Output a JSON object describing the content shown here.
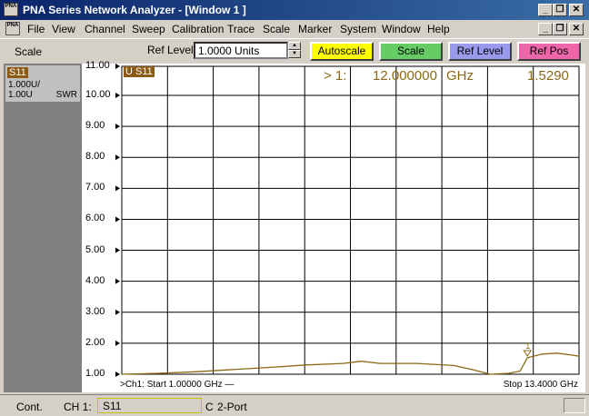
{
  "window": {
    "app_icon_text": "PNA",
    "title": "PNA Series Network Analyzer - [Window 1 ]",
    "controls": {
      "minimize": "_",
      "restore": "❐",
      "close": "✕"
    }
  },
  "menubar": {
    "items": [
      "File",
      "View",
      "Channel",
      "Sweep",
      "Calibration",
      "Trace",
      "Scale",
      "Marker",
      "System",
      "Window",
      "Help"
    ]
  },
  "toolbar": {
    "scale_label": "Scale",
    "ref_level_label": "Ref Level",
    "ref_level_value": "1.0000 Units",
    "spin_up": "▲",
    "spin_down": "▼",
    "buttons": [
      {
        "label": "Autoscale",
        "color": "#ffff00"
      },
      {
        "label": "Scale",
        "color": "#66cc66"
      },
      {
        "label": "Ref Level",
        "color": "#9999ee"
      },
      {
        "label": "Ref Pos",
        "color": "#ee66aa"
      }
    ]
  },
  "trace_panel": {
    "name": "S11",
    "scale_line1": "1.000U/",
    "scale_line2": "1.00U",
    "format": "SWR"
  },
  "plot": {
    "trace_label": "U S11",
    "marker_readout": {
      "marker": "> 1:",
      "frequency": "12.000000",
      "unit": "GHz",
      "value": "1.5290"
    },
    "y_ticks": [
      "11.00",
      "10.00",
      "9.00",
      "8.00",
      "7.00",
      "6.00",
      "5.00",
      "4.00",
      "3.00",
      "2.00",
      "1.00"
    ],
    "footer_left": ">Ch1: Start  1.00000 GHz —",
    "footer_right": "Stop  13.4000 GHz",
    "marker_number": "1",
    "trace_color": "#8b6914"
  },
  "chart_data": {
    "type": "line",
    "title": "",
    "xlabel": "",
    "ylabel": "",
    "xlim": [
      1.0,
      13.4
    ],
    "ylim": [
      1.0,
      11.0
    ],
    "x_unit": "GHz",
    "series": [
      {
        "x": [
          1.0,
          2.0,
          3.0,
          4.0,
          5.0,
          6.0,
          7.0,
          7.5,
          8.0,
          9.0,
          10.0,
          10.5,
          11.0,
          11.5,
          11.8,
          12.0,
          12.4,
          12.8,
          13.2,
          13.4
        ],
        "values": [
          1.0,
          1.03,
          1.08,
          1.15,
          1.22,
          1.3,
          1.35,
          1.42,
          1.35,
          1.35,
          1.28,
          1.15,
          1.0,
          1.03,
          1.1,
          1.53,
          1.65,
          1.68,
          1.62,
          1.58
        ]
      }
    ],
    "markers": [
      {
        "label": "1",
        "x": 12.0,
        "y": 1.529
      }
    ]
  },
  "statusbar": {
    "mode": "Cont.",
    "channel": "CH 1:",
    "measurement": "S11",
    "correction": "C",
    "config": "2-Port"
  }
}
